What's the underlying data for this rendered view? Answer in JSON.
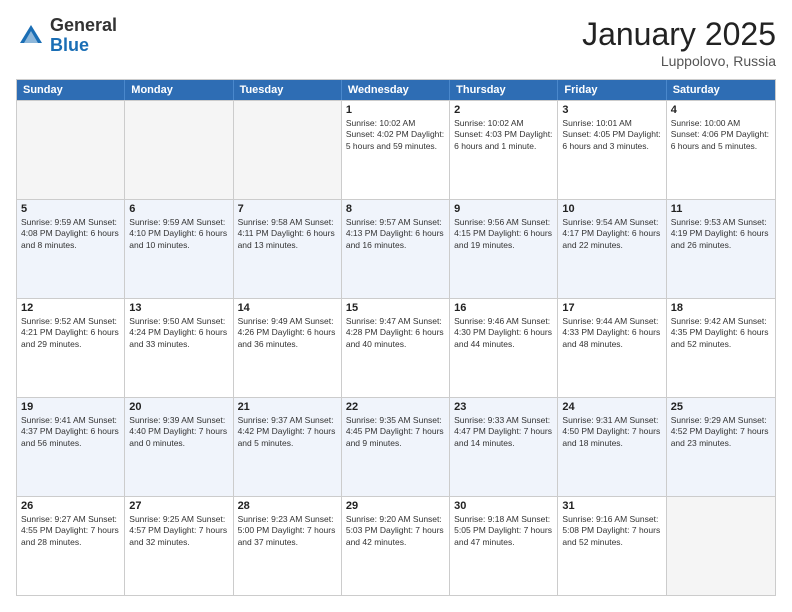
{
  "header": {
    "logo_general": "General",
    "logo_blue": "Blue",
    "month": "January 2025",
    "location": "Luppolovo, Russia"
  },
  "weekdays": [
    "Sunday",
    "Monday",
    "Tuesday",
    "Wednesday",
    "Thursday",
    "Friday",
    "Saturday"
  ],
  "rows": [
    [
      {
        "day": "",
        "info": "",
        "empty": true
      },
      {
        "day": "",
        "info": "",
        "empty": true
      },
      {
        "day": "",
        "info": "",
        "empty": true
      },
      {
        "day": "1",
        "info": "Sunrise: 10:02 AM\nSunset: 4:02 PM\nDaylight: 5 hours\nand 59 minutes."
      },
      {
        "day": "2",
        "info": "Sunrise: 10:02 AM\nSunset: 4:03 PM\nDaylight: 6 hours\nand 1 minute."
      },
      {
        "day": "3",
        "info": "Sunrise: 10:01 AM\nSunset: 4:05 PM\nDaylight: 6 hours\nand 3 minutes."
      },
      {
        "day": "4",
        "info": "Sunrise: 10:00 AM\nSunset: 4:06 PM\nDaylight: 6 hours\nand 5 minutes."
      }
    ],
    [
      {
        "day": "5",
        "info": "Sunrise: 9:59 AM\nSunset: 4:08 PM\nDaylight: 6 hours\nand 8 minutes."
      },
      {
        "day": "6",
        "info": "Sunrise: 9:59 AM\nSunset: 4:10 PM\nDaylight: 6 hours\nand 10 minutes."
      },
      {
        "day": "7",
        "info": "Sunrise: 9:58 AM\nSunset: 4:11 PM\nDaylight: 6 hours\nand 13 minutes."
      },
      {
        "day": "8",
        "info": "Sunrise: 9:57 AM\nSunset: 4:13 PM\nDaylight: 6 hours\nand 16 minutes."
      },
      {
        "day": "9",
        "info": "Sunrise: 9:56 AM\nSunset: 4:15 PM\nDaylight: 6 hours\nand 19 minutes."
      },
      {
        "day": "10",
        "info": "Sunrise: 9:54 AM\nSunset: 4:17 PM\nDaylight: 6 hours\nand 22 minutes."
      },
      {
        "day": "11",
        "info": "Sunrise: 9:53 AM\nSunset: 4:19 PM\nDaylight: 6 hours\nand 26 minutes."
      }
    ],
    [
      {
        "day": "12",
        "info": "Sunrise: 9:52 AM\nSunset: 4:21 PM\nDaylight: 6 hours\nand 29 minutes."
      },
      {
        "day": "13",
        "info": "Sunrise: 9:50 AM\nSunset: 4:24 PM\nDaylight: 6 hours\nand 33 minutes."
      },
      {
        "day": "14",
        "info": "Sunrise: 9:49 AM\nSunset: 4:26 PM\nDaylight: 6 hours\nand 36 minutes."
      },
      {
        "day": "15",
        "info": "Sunrise: 9:47 AM\nSunset: 4:28 PM\nDaylight: 6 hours\nand 40 minutes."
      },
      {
        "day": "16",
        "info": "Sunrise: 9:46 AM\nSunset: 4:30 PM\nDaylight: 6 hours\nand 44 minutes."
      },
      {
        "day": "17",
        "info": "Sunrise: 9:44 AM\nSunset: 4:33 PM\nDaylight: 6 hours\nand 48 minutes."
      },
      {
        "day": "18",
        "info": "Sunrise: 9:42 AM\nSunset: 4:35 PM\nDaylight: 6 hours\nand 52 minutes."
      }
    ],
    [
      {
        "day": "19",
        "info": "Sunrise: 9:41 AM\nSunset: 4:37 PM\nDaylight: 6 hours\nand 56 minutes."
      },
      {
        "day": "20",
        "info": "Sunrise: 9:39 AM\nSunset: 4:40 PM\nDaylight: 7 hours\nand 0 minutes."
      },
      {
        "day": "21",
        "info": "Sunrise: 9:37 AM\nSunset: 4:42 PM\nDaylight: 7 hours\nand 5 minutes."
      },
      {
        "day": "22",
        "info": "Sunrise: 9:35 AM\nSunset: 4:45 PM\nDaylight: 7 hours\nand 9 minutes."
      },
      {
        "day": "23",
        "info": "Sunrise: 9:33 AM\nSunset: 4:47 PM\nDaylight: 7 hours\nand 14 minutes."
      },
      {
        "day": "24",
        "info": "Sunrise: 9:31 AM\nSunset: 4:50 PM\nDaylight: 7 hours\nand 18 minutes."
      },
      {
        "day": "25",
        "info": "Sunrise: 9:29 AM\nSunset: 4:52 PM\nDaylight: 7 hours\nand 23 minutes."
      }
    ],
    [
      {
        "day": "26",
        "info": "Sunrise: 9:27 AM\nSunset: 4:55 PM\nDaylight: 7 hours\nand 28 minutes."
      },
      {
        "day": "27",
        "info": "Sunrise: 9:25 AM\nSunset: 4:57 PM\nDaylight: 7 hours\nand 32 minutes."
      },
      {
        "day": "28",
        "info": "Sunrise: 9:23 AM\nSunset: 5:00 PM\nDaylight: 7 hours\nand 37 minutes."
      },
      {
        "day": "29",
        "info": "Sunrise: 9:20 AM\nSunset: 5:03 PM\nDaylight: 7 hours\nand 42 minutes."
      },
      {
        "day": "30",
        "info": "Sunrise: 9:18 AM\nSunset: 5:05 PM\nDaylight: 7 hours\nand 47 minutes."
      },
      {
        "day": "31",
        "info": "Sunrise: 9:16 AM\nSunset: 5:08 PM\nDaylight: 7 hours\nand 52 minutes."
      },
      {
        "day": "",
        "info": "",
        "empty": true
      }
    ]
  ]
}
